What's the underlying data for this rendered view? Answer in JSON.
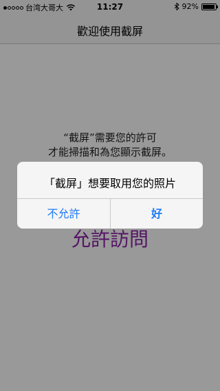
{
  "status_bar": {
    "carrier": "台湾大哥大",
    "time": "11:27",
    "battery_percent": "92%",
    "battery_level": 0.92,
    "signal_bars_filled": 1,
    "signal_bars_total": 5,
    "icons": [
      "signal-dots-icon",
      "wifi-icon",
      "bluetooth-icon",
      "battery-icon"
    ]
  },
  "nav": {
    "title": "歡迎使用截屏"
  },
  "content": {
    "message_lines": [
      "“截屏”需要您的許可",
      "才能掃描和為您顯示截屏。"
    ],
    "allow_link": "允許訪問"
  },
  "alert": {
    "title": "「截屏」想要取用您的照片",
    "deny_label": "不允許",
    "ok_label": "好"
  },
  "colors": {
    "button_blue": "#1e7bf6",
    "link_purple": "#8e24aa"
  }
}
